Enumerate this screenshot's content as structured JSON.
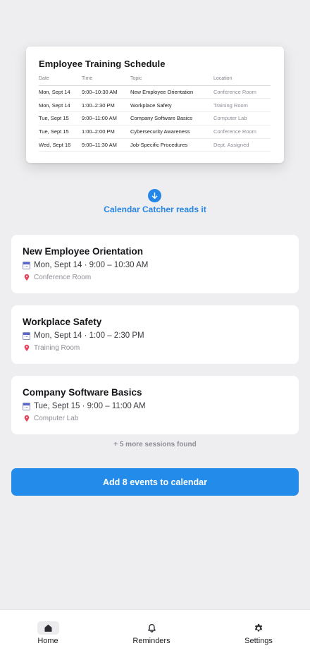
{
  "document": {
    "title": "Employee Training Schedule",
    "columns": [
      "Date",
      "Time",
      "Topic",
      "Location"
    ],
    "rows": [
      [
        "Mon, Sept 14",
        "9:00–10:30 AM",
        "New Employee Orientation",
        "Conference Room"
      ],
      [
        "Mon, Sept 14",
        "1:00–2:30 PM",
        "Workplace Safety",
        "Training Room"
      ],
      [
        "Tue, Sept 15",
        "9:00–11:00 AM",
        "Company Software Basics",
        "Computer Lab"
      ],
      [
        "Tue, Sept 15",
        "1:00–2:00 PM",
        "Cybersecurity Awareness",
        "Conference Room"
      ],
      [
        "Wed, Sept 16",
        "9:00–11:30 AM",
        "Job-Specific Procedures",
        "Dept. Assigned"
      ]
    ]
  },
  "reader": {
    "label": "Calendar Catcher reads it",
    "icon": "arrow-down-icon"
  },
  "sessions": [
    {
      "title": "New Employee Orientation",
      "when": "Mon, Sept 14 · 9:00 – 10:30 AM",
      "where": "Conference Room"
    },
    {
      "title": "Workplace Safety",
      "when": "Mon, Sept 14 · 1:00 – 2:30 PM",
      "where": "Training Room"
    },
    {
      "title": "Company Software Basics",
      "when": "Tue, Sept 15 · 9:00 – 11:00 AM",
      "where": "Computer Lab"
    }
  ],
  "more_sessions_label": "+ 5 more sessions found",
  "add_button_label": "Add 8 events to calendar",
  "tabs": [
    {
      "label": "Home",
      "icon": "home-icon",
      "active": true
    },
    {
      "label": "Reminders",
      "icon": "bell-icon",
      "active": false
    },
    {
      "label": "Settings",
      "icon": "gear-icon",
      "active": false
    }
  ],
  "colors": {
    "accent": "#238be9",
    "background": "#eeeef1",
    "card": "#ffffff"
  }
}
